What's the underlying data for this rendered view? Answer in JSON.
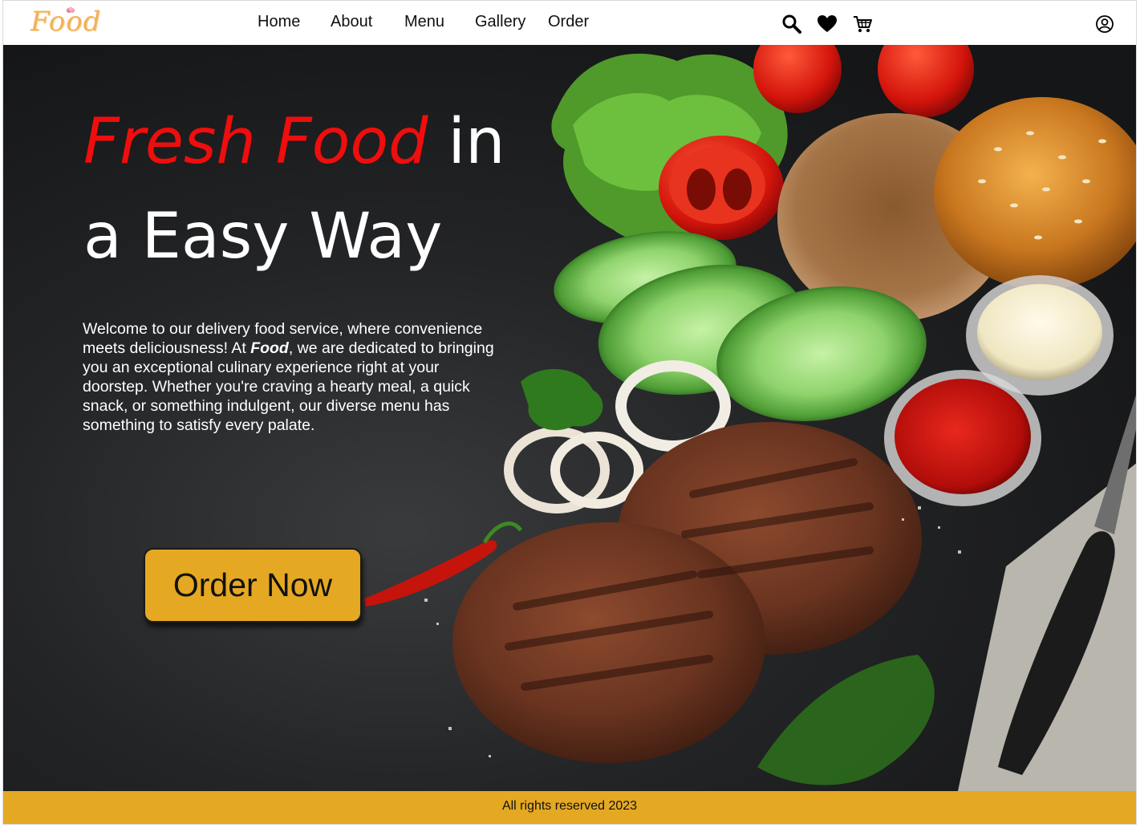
{
  "brand": {
    "logo_text": "Food"
  },
  "nav": {
    "items": [
      {
        "label": "Home"
      },
      {
        "label": "About"
      },
      {
        "label": "Menu"
      },
      {
        "label": "Gallery"
      },
      {
        "label": "Order"
      }
    ],
    "icons": [
      "search-icon",
      "heart-icon",
      "cart-icon",
      "user-icon"
    ]
  },
  "hero": {
    "headline_accent": "Fresh Food",
    "headline_rest_1": " in",
    "headline_rest_2": "a Easy Way",
    "intro_before": "Welcome to our delivery food service, where convenience meets deliciousness! At ",
    "intro_brand": "Food",
    "intro_after": ", we are dedicated to bringing you an exceptional culinary experience right at your doorstep. Whether you're craving a hearty meal, a quick snack, or something indulgent, our diverse menu has something to satisfy every palate.",
    "cta_label": "Order Now"
  },
  "footer": {
    "text": "All rights reserved 2023"
  },
  "colors": {
    "accent_red": "#f00d0d",
    "brand_gold": "#e5a823",
    "logo_orange": "#f2b15a"
  }
}
